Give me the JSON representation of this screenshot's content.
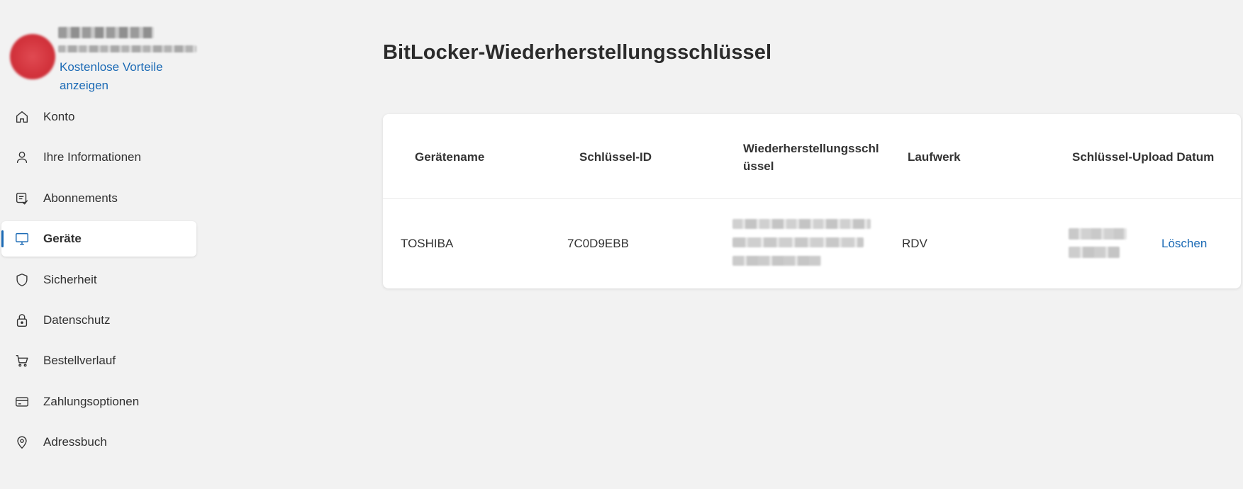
{
  "profile": {
    "link_text": "Kostenlose Vorteile anzeigen"
  },
  "nav": {
    "items": [
      {
        "label": "Konto",
        "icon": "home-icon"
      },
      {
        "label": "Ihre Informationen",
        "icon": "person-icon"
      },
      {
        "label": "Abonnements",
        "icon": "subscription-icon"
      },
      {
        "label": "Geräte",
        "icon": "monitor-icon",
        "active": true
      },
      {
        "label": "Sicherheit",
        "icon": "shield-icon"
      },
      {
        "label": "Datenschutz",
        "icon": "lock-icon"
      },
      {
        "label": "Bestellverlauf",
        "icon": "cart-icon"
      },
      {
        "label": "Zahlungsoptionen",
        "icon": "card-icon"
      },
      {
        "label": "Adressbuch",
        "icon": "location-pin-icon"
      }
    ]
  },
  "main": {
    "title": "BitLocker-Wiederherstellungsschlüssel",
    "table": {
      "columns": [
        "Gerätename",
        "Schlüssel-ID",
        "Wiederherstellungsschlüssel",
        "Laufwerk",
        "Schlüssel-Upload Datum"
      ],
      "rows": [
        {
          "device": "TOSHIBA",
          "key_id": "7C0D9EBB",
          "drive": "RDV",
          "action": "Löschen"
        }
      ]
    }
  },
  "colors": {
    "accent": "#1b6ab5",
    "background": "#f2f2f2",
    "card": "#ffffff",
    "avatar": "#d3343d"
  }
}
